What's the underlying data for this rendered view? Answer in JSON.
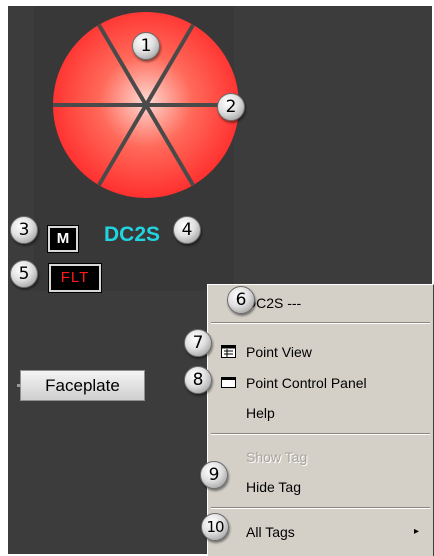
{
  "valve": {
    "state_color": "#ff2a2a",
    "spoke_color": "#4a4a4a"
  },
  "mode_button": {
    "label": "M"
  },
  "fault_indicator": {
    "label": "FLT",
    "color": "#ff1a1a"
  },
  "tag_name": {
    "label": "DC2S",
    "color": "#22d3e0"
  },
  "faceplate_button": {
    "label": "Faceplate"
  },
  "context_menu": {
    "header": "DC2S ---",
    "items": [
      {
        "label": "Point View",
        "icon": "point-view-icon"
      },
      {
        "label": "Point Control Panel",
        "icon": "control-panel-icon"
      },
      {
        "label": "Help"
      },
      {
        "label": "Show Tag",
        "disabled": true
      },
      {
        "label": "Hide Tag"
      },
      {
        "label": "All Tags",
        "submenu_arrow": "▸"
      }
    ]
  },
  "callouts": [
    "1",
    "2",
    "3",
    "4",
    "5",
    "6",
    "7",
    "8",
    "9",
    "10"
  ]
}
